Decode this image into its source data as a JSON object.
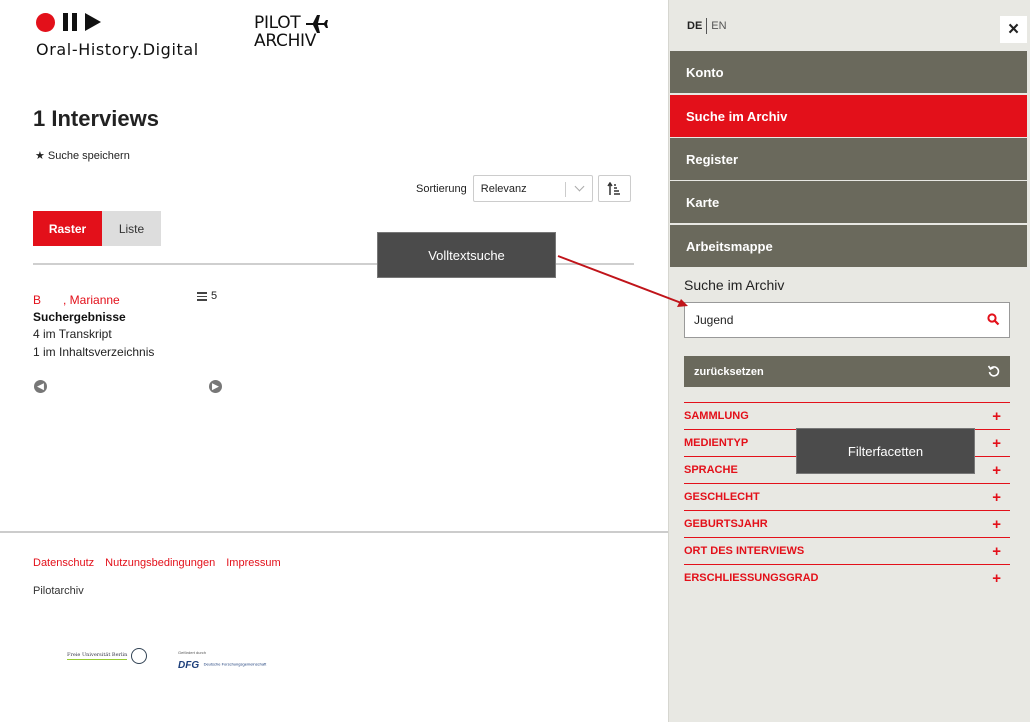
{
  "brand": {
    "name": "Oral-History.Digital",
    "archive_line1": "PILOT",
    "archive_line2": "ARCHIV"
  },
  "main": {
    "title": "1 Interviews",
    "save_search": "Suche speichern",
    "sort": {
      "label": "Sortierung",
      "selected": "Relevanz"
    },
    "view_tabs": [
      {
        "label": "Raster",
        "active": true
      },
      {
        "label": "Liste",
        "active": false
      }
    ]
  },
  "result": {
    "name_initial": "B",
    "name_rest": ", Marianne",
    "segment_count": "5",
    "heading": "Suchergebnisse",
    "lines": [
      "4 im Transkript",
      "1 im Inhaltsverzeichnis"
    ]
  },
  "footer": {
    "links": [
      "Datenschutz",
      "Nutzungsbedingungen",
      "Impressum"
    ],
    "name": "Pilotarchiv",
    "fu_text": "Freie Universität Berlin",
    "dfg_small": "Gefördert durch",
    "dfg_mark": "DFG",
    "dfg_sub": "Deutsche Forschungsgemeinschaft"
  },
  "sidebar": {
    "lang": {
      "de": "DE",
      "en": "EN"
    },
    "close": "×",
    "nav": [
      {
        "label": "Konto",
        "active": false
      },
      {
        "label": "Suche im Archiv",
        "active": true
      },
      {
        "label": "Register",
        "active": false
      },
      {
        "label": "Karte",
        "active": false
      },
      {
        "label": "Arbeitsmappe",
        "active": false
      }
    ],
    "search_heading": "Suche im Archiv",
    "search_value": "Jugend",
    "reset_label": "zurücksetzen",
    "facets": [
      "SAMMLUNG",
      "MEDIENTYP",
      "SPRACHE",
      "GESCHLECHT",
      "GEBURTSJAHR",
      "ORT DES INTERVIEWS",
      "ERSCHLIESSUNGSGRAD"
    ]
  },
  "annotations": {
    "fulltext": "Volltextsuche",
    "facets": "Filterfacetten"
  },
  "colors": {
    "accent": "#e3101a",
    "nav": "#6a695c",
    "sidebar_bg": "#e8e8e3"
  }
}
